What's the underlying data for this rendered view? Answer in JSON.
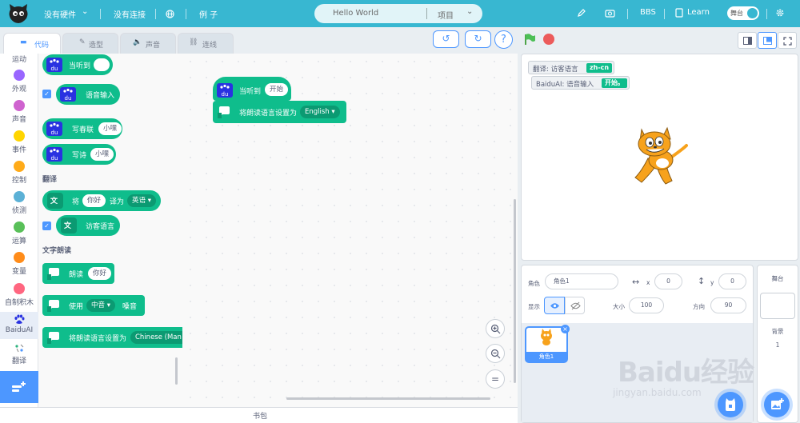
{
  "colors": {
    "topbar": "#38b7d1",
    "accent": "#4d97ff",
    "extension_block": "#0fbd8c",
    "stop": "#ec5b5b"
  },
  "menu": {
    "hardware": "没有硬件",
    "connection": "没有连接",
    "examples": "例 子",
    "project_name": "Hello World",
    "project_menu": "项目",
    "bbs": "BBS",
    "learn": "Learn",
    "stage_toggle": "舞台"
  },
  "tabs": [
    {
      "label": "代码"
    },
    {
      "label": "造型"
    },
    {
      "label": "声音"
    },
    {
      "label": "连线"
    }
  ],
  "categories": [
    {
      "label": "运动",
      "color": "#4c97ff"
    },
    {
      "label": "外观",
      "color": "#9966ff"
    },
    {
      "label": "声音",
      "color": "#cf63cf"
    },
    {
      "label": "事件",
      "color": "#ffd500"
    },
    {
      "label": "控制",
      "color": "#ffab19"
    },
    {
      "label": "侦测",
      "color": "#5cb1d6"
    },
    {
      "label": "运算",
      "color": "#59c059"
    },
    {
      "label": "变量",
      "color": "#ff8c1a"
    },
    {
      "label": "自制积木",
      "color": "#ff6680"
    },
    {
      "label": "BaiduAI",
      "color": ""
    },
    {
      "label": "翻译",
      "color": ""
    }
  ],
  "palette": {
    "when_heard": "当听到",
    "voice_input": "语音输入",
    "couplet": "写春联",
    "couplet_arg": "小嘿",
    "poem": "写诗",
    "poem_arg": "小嘿",
    "translate_section": "翻译",
    "translate_word": "将",
    "translate_arg": "你好",
    "translate_to": "译为",
    "translate_lang": "英语",
    "visitor_lang": "访客语言",
    "tts_section": "文字朗读",
    "speak": "朗读",
    "speak_arg": "你好",
    "use": "使用",
    "voice": "中音",
    "voice_suffix": "嗓音",
    "set_lang": "将朗读语言设置为",
    "set_lang_arg": "Chinese (Man"
  },
  "script": {
    "hat_label": "当听到",
    "hat_arg": "开始",
    "set_lang": "将朗读语言设置为",
    "set_lang_value": "English"
  },
  "backpack": "书包",
  "stage": {
    "monitor1_label": "翻译: 访客语言",
    "monitor1_value": "zh-cn",
    "monitor2_label": "BaiduAI: 语音输入",
    "monitor2_value": "开始。"
  },
  "sprite_info": {
    "sprite_label": "角色",
    "sprite_name": "角色1",
    "x_label": "x",
    "x_value": "0",
    "y_label": "y",
    "y_value": "0",
    "show_label": "显示",
    "size_label": "大小",
    "size_value": "100",
    "direction_label": "方向",
    "direction_value": "90"
  },
  "sprite_list": [
    {
      "name": "角色1"
    }
  ],
  "backdrop_panel": {
    "title": "舞台",
    "backdrops_label": "背景",
    "backdrops_count": "1"
  },
  "watermark": {
    "line1": "Baidu经验",
    "line2": "jingyan.baidu.com"
  }
}
